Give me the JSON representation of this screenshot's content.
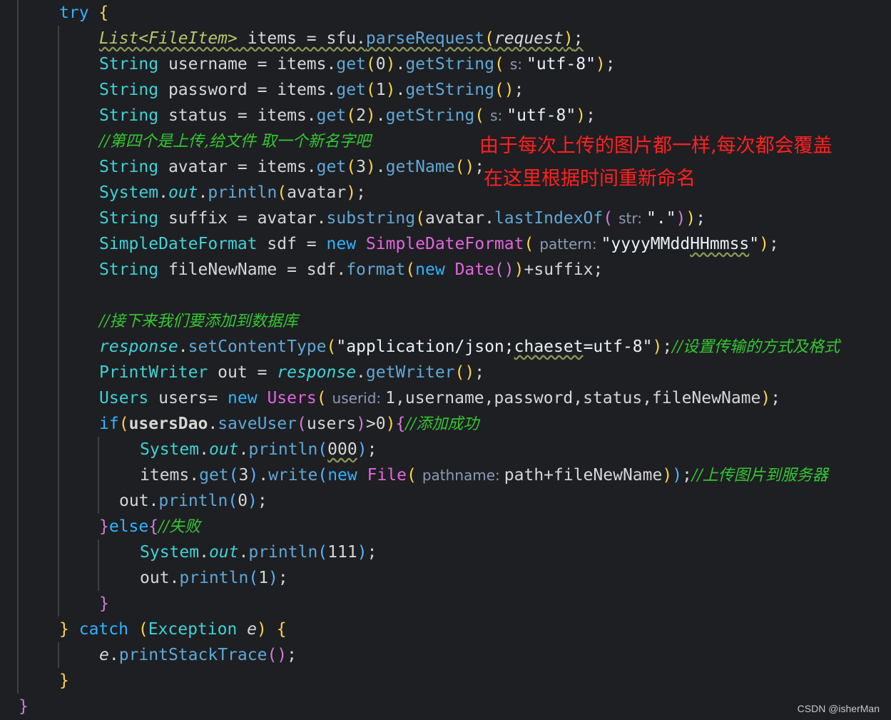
{
  "annotations": {
    "line1": "由于每次上传的图片都一样,每次都会覆盖",
    "line2": "在这里根据时间重新命名"
  },
  "comments": {
    "c_rename": "//第四个是上传,给文件 取一个新名字吧",
    "c_db": "//接下来我们要添加到数据库",
    "c_transfer": "//设置传输的方式及格式",
    "c_success": "//添加成功",
    "c_upload": "//上传图片到服务器",
    "c_fail": "//失败"
  },
  "code": {
    "try": "try",
    "catch": "catch",
    "list_type": "List<FileItem>",
    "items_var": " items = sfu.",
    "parse_request": "parseRequest",
    "request_arg": "request",
    "string": "String",
    "username_decl": " username = items.",
    "password_decl": " password = items.",
    "status_decl": " status = items.",
    "avatar_decl": " avatar = items.",
    "suffix_decl": " suffix = avatar.",
    "filename_decl": " fileNewName = sdf.",
    "get": "get",
    "getString": "getString",
    "getName": "getName",
    "hint_s": "s:",
    "hint_str": "str:",
    "hint_pattern": "pattern:",
    "hint_userid": "userid:",
    "hint_pathname": "pathname:",
    "utf8": "\"utf-8\"",
    "dot_str": "\".\"",
    "date_pattern_a": "\"yyyyMMdd",
    "date_pattern_b": "HHmmss",
    "date_pattern_c": "\"",
    "system": "System",
    "out": "out",
    "println": "println",
    "avatar_arg": "avatar",
    "substring": "substring",
    "lastIndexOf": "lastIndexOf",
    "sdf_type": "SimpleDateFormat",
    "sdf_decl": " sdf = ",
    "new": "new",
    "format": "format",
    "date": "Date",
    "suffix_tail": "+suffix;",
    "response": "response",
    "setContentType": "setContentType",
    "ct_a": "\"application/json;",
    "ct_b": "chaeset",
    "ct_c": "=utf-8\"",
    "print_writer": "PrintWriter",
    "out_decl": " out = ",
    "getWriter": "getWriter",
    "users_type": "Users",
    "users_decl": " users= ",
    "users_args": "1,username,password,status,fileNewName",
    "if": "if",
    "users_dao": "usersDao",
    "saveUser": "saveUser",
    "users_arg": "users",
    "gt_zero": ">0",
    "n000": "000",
    "items_obj": "items.",
    "write": "write",
    "file": "File",
    "path_args": "path+fileNewName",
    "out_obj": "out.",
    "else": "else",
    "n111": "111",
    "n0": "0",
    "n1": "1",
    "n2": "2",
    "n3": "3",
    "exception": "Exception",
    "e_var": "e",
    "printStackTrace": "printStackTrace"
  },
  "watermark": "CSDN @isherMan"
}
